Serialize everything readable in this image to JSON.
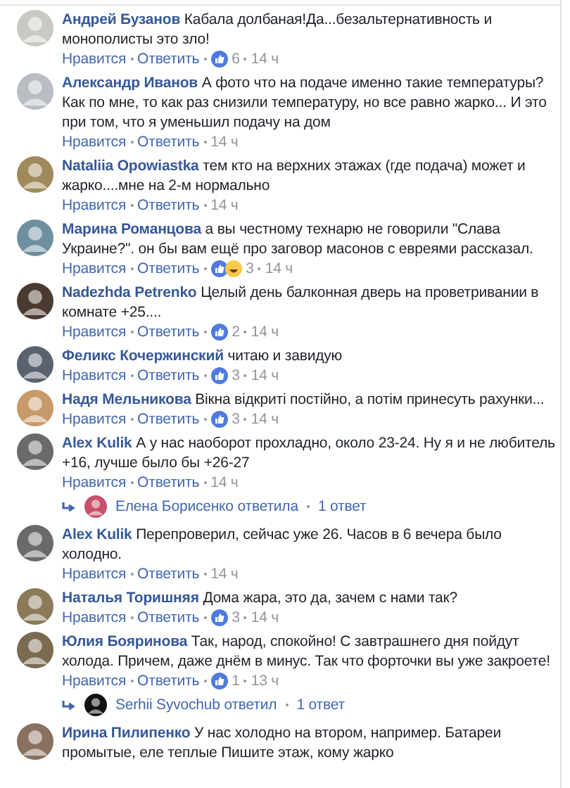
{
  "comments": [
    {
      "author": "Андрей Бузанов",
      "text": "Кабала долбаная!Да...безальтернативность и монополисты это зло!",
      "color": "#c9c9c4",
      "like": "Нравится",
      "reply": "Ответить",
      "reactions": [
        {
          "kind": "like"
        }
      ],
      "count": "6",
      "time": "14 ч"
    },
    {
      "author": "Александр Иванов",
      "text": "А фото что на подаче именно такие температуры? Как по мне, то как раз снизили температуру, но все равно жарко... И это при том, что я уменьшил подачу на дом",
      "color": "#b9bcc2",
      "like": "Нравится",
      "reply": "Ответить",
      "time": "14 ч"
    },
    {
      "author": "Nataliia Opowiastka",
      "text": "тем кто на верхних этажах (где подача) может и жарко....мне на 2-м нормально",
      "color": "#a08a5c",
      "like": "Нравится",
      "reply": "Ответить",
      "time": "14 ч"
    },
    {
      "author": "Марина Романцова",
      "text": "а вы честному технарю не говорили \"Слава Украине?\". он бы вам ещё про заговор масонов с евреями рассказал.",
      "color": "#6f8fa0",
      "like": "Нравится",
      "reply": "Ответить",
      "reactions": [
        {
          "kind": "like"
        },
        {
          "kind": "haha"
        }
      ],
      "count": "3",
      "time": "14 ч"
    },
    {
      "author": "Nadezhda Petrenko",
      "text": "Целый день балконная дверь на проветривании в комнате +25....",
      "color": "#4a3a30",
      "like": "Нравится",
      "reply": "Ответить",
      "reactions": [
        {
          "kind": "like"
        }
      ],
      "count": "2",
      "time": "14 ч"
    },
    {
      "author": "Феликс Кочержинский",
      "text": "читаю и завидую",
      "color": "#5a6270",
      "like": "Нравится",
      "reply": "Ответить",
      "reactions": [
        {
          "kind": "like"
        }
      ],
      "count": "3",
      "time": "14 ч"
    },
    {
      "author": "Надя Мельникова",
      "text": "Вікна відкриті постійно, а потім принесуть рахунки...",
      "color": "#c89a6a",
      "like": "Нравится",
      "reply": "Ответить",
      "reactions": [
        {
          "kind": "like"
        }
      ],
      "count": "3",
      "time": "14 ч"
    },
    {
      "author": "Alex Kulik",
      "text": "А у нас наоборот прохладно, около 23-24. Ну я и не любитель +16, лучше было бы +26-27",
      "color": "#6a6a6a",
      "like": "Нравится",
      "reply": "Ответить",
      "time": "14 ч",
      "replies": {
        "author": "Елена Борисенко",
        "verb": "ответила",
        "count": "1 ответ",
        "color": "#c8506a"
      }
    },
    {
      "author": "Alex Kulik",
      "text": "Перепроверил, сейчас уже 26. Часов в 6 вечера было холодно.",
      "color": "#6a6a6a",
      "like": "Нравится",
      "reply": "Ответить",
      "time": "14 ч"
    },
    {
      "author": "Наталья Торишняя",
      "text": "Дома жара, это да, зачем с нами так?",
      "color": "#8a7a5a",
      "like": "Нравится",
      "reply": "Ответить",
      "reactions": [
        {
          "kind": "like"
        }
      ],
      "count": "3",
      "time": "14 ч"
    },
    {
      "author": "Юлия Бояринова",
      "text": "Так, народ, спокойно! С завтрашнего дня пойдут холода. Причем, даже днём в минус. Так что форточки вы уже закроете!",
      "color": "#7a6a50",
      "like": "Нравится",
      "reply": "Ответить",
      "reactions": [
        {
          "kind": "like"
        }
      ],
      "count": "1",
      "time": "13 ч",
      "replies": {
        "author": "Serhii Syvochub",
        "verb": "ответил",
        "count": "1 ответ",
        "color": "#111111"
      }
    },
    {
      "author": "Ирина Пилипенко",
      "text": "У нас холодно на втором, например. Батареи промытые, еле теплые Пишите этаж, кому жарко",
      "color": "#8a7060"
    }
  ]
}
